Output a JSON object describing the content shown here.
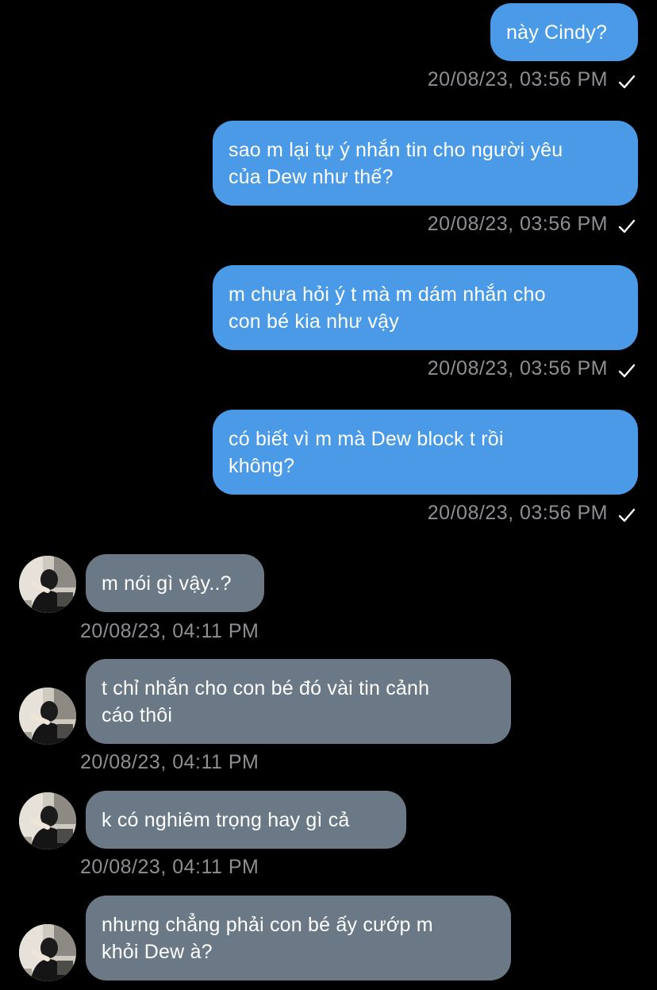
{
  "outgoing": [
    {
      "text": "này Cindy?",
      "time": "20/08/23, 03:56 PM"
    },
    {
      "text": "sao m lại tự ý nhắn tin cho người yêu\ncủa Dew như thế?",
      "time": "20/08/23, 03:56 PM"
    },
    {
      "text": "m chưa hỏi ý t mà m dám nhắn cho\ncon bé kia như vậy",
      "time": "20/08/23, 03:56 PM"
    },
    {
      "text": "có biết vì m mà Dew block t rồi\nkhông?",
      "time": "20/08/23, 03:56 PM"
    }
  ],
  "incoming": [
    {
      "text": "m nói gì vậy..?",
      "time": "20/08/23, 04:11 PM"
    },
    {
      "text": "t chỉ nhắn cho con bé đó vài tin cảnh\ncáo thôi",
      "time": "20/08/23, 04:11 PM"
    },
    {
      "text": "k có nghiêm trọng hay gì cả",
      "time": "20/08/23, 04:11 PM"
    },
    {
      "text": "nhưng chẳng phải con bé ấy cướp m\nkhỏi Dew à?"
    }
  ],
  "colors": {
    "outgoing_bubble": "#4a9ae8",
    "incoming_bubble": "#6b7987",
    "timestamp": "#8e8e93",
    "background": "#000000"
  },
  "icons": {
    "read_receipt": "checkmark-icon",
    "avatar": "contact-avatar"
  }
}
